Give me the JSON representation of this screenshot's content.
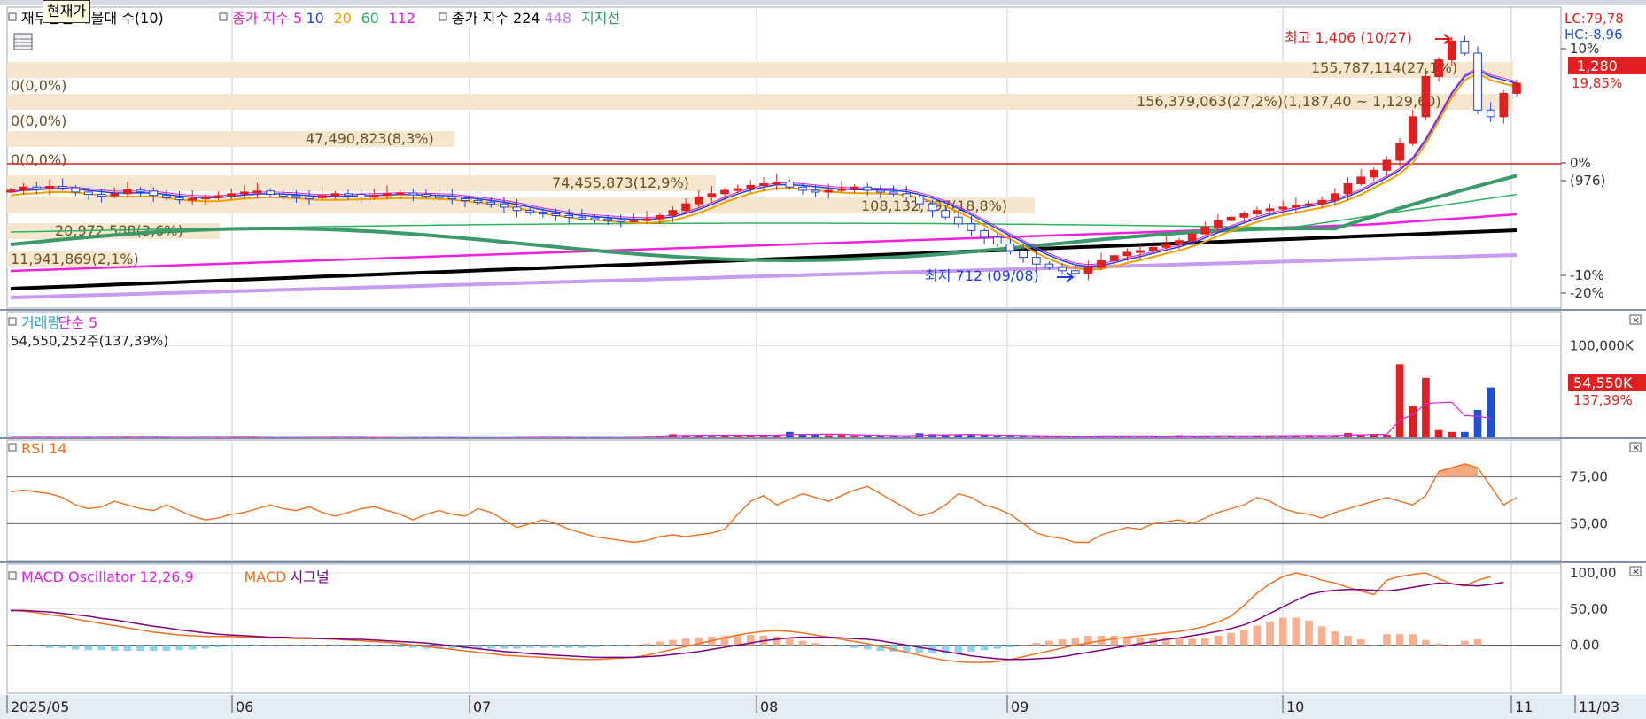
{
  "tooltip": "현재가",
  "legends": {
    "price": [
      {
        "text": "재무관련 매물대 수(10)",
        "color": "#000000"
      },
      {
        "text": "종가 지수 5",
        "color": "#e020c0"
      },
      {
        "text": "10",
        "color": "#2040e0"
      },
      {
        "text": "20",
        "color": "#f0a000"
      },
      {
        "text": "60",
        "color": "#30b060"
      },
      {
        "text": "112",
        "color": "#e020e0"
      },
      {
        "text": "종가 지수 224",
        "color": "#000000"
      },
      {
        "text": "448",
        "color": "#c080f0"
      },
      {
        "text": "지지선",
        "color": "#30a060"
      }
    ],
    "volume": [
      {
        "text": "거래량",
        "color": "#20a0c0"
      },
      {
        "text": "단순 5",
        "color": "#e020e0"
      }
    ],
    "volume_info": "54,550,252주(137,39%)",
    "rsi": [
      {
        "text": "RSI 14",
        "color": "#f07020"
      }
    ],
    "macd": [
      {
        "text": "MACD Oscillator 12,26,9",
        "color": "#e020e0"
      },
      {
        "text": "MACD",
        "color": "#f07020"
      },
      {
        "text": "시그널",
        "color": "#800080"
      }
    ]
  },
  "right_axis": {
    "lc": "LC:79,78",
    "hc": "HC:-8,96",
    "price_badge": "1,280",
    "price_change": "19,85%",
    "price_ticks": [
      "10%",
      "0%",
      "(976)",
      "-10%",
      "-20%"
    ],
    "volume_ticks": [
      "100,000K"
    ],
    "volume_badge": "54,550K",
    "volume_change": "137,39%",
    "rsi_ticks": [
      "75,00",
      "50,00"
    ],
    "macd_ticks": [
      "100,00",
      "50,00",
      "0,00"
    ]
  },
  "x_axis": {
    "labels": [
      "2025/05",
      "06",
      "07",
      "08",
      "09",
      "10",
      "11",
      "11/03"
    ]
  },
  "annotations": {
    "high": "최고 1,406 (10/27)",
    "low": "최저 712 (09/08)"
  },
  "chart_data": {
    "type": "candlestick",
    "x_range": [
      "2025/05",
      "11/03"
    ],
    "price": {
      "current": 1280,
      "high": {
        "value": 1406,
        "date": "10/27"
      },
      "low": {
        "value": 712,
        "date": "09/08"
      },
      "reference": 976,
      "closes": [
        960,
        970,
        965,
        972,
        968,
        955,
        948,
        944,
        950,
        962,
        958,
        945,
        938,
        932,
        936,
        940,
        944,
        950,
        955,
        958,
        948,
        944,
        940,
        938,
        945,
        950,
        948,
        940,
        945,
        950,
        952,
        948,
        944,
        940,
        935,
        930,
        925,
        920,
        910,
        900,
        895,
        890,
        885,
        880,
        878,
        875,
        872,
        870,
        872,
        875,
        885,
        900,
        920,
        940,
        950,
        960,
        965,
        975,
        980,
        985,
        970,
        960,
        955,
        960,
        965,
        970,
        960,
        955,
        950,
        940,
        920,
        900,
        880,
        860,
        840,
        820,
        800,
        780,
        760,
        740,
        730,
        720,
        712,
        730,
        750,
        765,
        775,
        780,
        790,
        800,
        810,
        830,
        850,
        870,
        880,
        890,
        900,
        905,
        910,
        915,
        920,
        930,
        950,
        980,
        1000,
        1020,
        1050,
        1100,
        1180,
        1300,
        1350,
        1406,
        1370,
        1200,
        1180,
        1250,
        1280
      ],
      "sma5": [
        955,
        960,
        962,
        965,
        966,
        964,
        960,
        956,
        952,
        952,
        953,
        952,
        948,
        943,
        940,
        938,
        938,
        942,
        946,
        949,
        950,
        949,
        947,
        944,
        942,
        942,
        943,
        944,
        945,
        946,
        948,
        947,
        946,
        945,
        943,
        939,
        935,
        930,
        925,
        918,
        910,
        902,
        896,
        890,
        885,
        882,
        879,
        876,
        874,
        873,
        876,
        881,
        891,
        903,
        918,
        935,
        949,
        961,
        970,
        977,
        977,
        975,
        971,
        967,
        964,
        962,
        962,
        961,
        960,
        956,
        948,
        937,
        923,
        906,
        887,
        866,
        845,
        825,
        805,
        784,
        766,
        750,
        738,
        733,
        736,
        744,
        754,
        762,
        772,
        782,
        791,
        803,
        818,
        834,
        849,
        863,
        876,
        887,
        896,
        904,
        912,
        919,
        928,
        942,
        958,
        978,
        998,
        1020,
        1054,
        1110,
        1178,
        1248,
        1300,
        1320,
        1300,
        1290,
        1280
      ],
      "ma224": [
        930,
        932,
        934,
        936,
        938,
        940,
        942,
        944,
        946,
        948,
        950,
        952,
        954,
        956,
        958,
        960,
        962,
        964,
        966,
        968,
        970,
        972,
        974,
        976,
        978,
        980,
        982,
        984,
        986,
        988,
        990,
        992,
        994,
        996,
        998,
        1000,
        1002,
        1004,
        1006,
        1008,
        1010,
        1012,
        1014,
        1016,
        1018,
        1020,
        1022,
        1024,
        1026,
        1028,
        1030,
        1032,
        1034,
        1036,
        1038,
        1040,
        1042,
        1044,
        1046,
        1048,
        1050,
        1052,
        1054,
        1056,
        1058,
        1060,
        1062,
        1064,
        1066,
        1068,
        1070,
        1072,
        1074,
        1076,
        1078,
        1080,
        1082,
        1084,
        1086,
        1088,
        1090,
        1092,
        1094,
        1096,
        1098,
        1100,
        1102,
        1104,
        1106,
        1108,
        1110,
        1112,
        1114,
        1116,
        1118,
        1120,
        1122,
        1124,
        1126,
        1128,
        1130,
        1132,
        1134,
        1136,
        1138,
        1140,
        1142,
        1144,
        1146,
        1148,
        1150,
        1152,
        1154,
        1156,
        1158
      ]
    },
    "volume_profile": [
      {
        "label": "0(0,0%)",
        "pct": 0
      },
      {
        "label": "155,787,114(27,1%)",
        "pct": 27.1
      },
      {
        "label": "0(0,0%)",
        "pct": 0
      },
      {
        "label": "156,379,063(27,2%)(1,187,40 ~ 1,129,60)",
        "pct": 27.2
      },
      {
        "label": "47,490,823(8,3%)",
        "pct": 8.3
      },
      {
        "label": "0(0,0%)",
        "pct": 0
      },
      {
        "label": "74,455,873(12,9%)",
        "pct": 12.9
      },
      {
        "label": "108,132,797(18,8%)",
        "pct": 18.8
      },
      {
        "label": "20,972,588(3,6%)",
        "pct": 3.6
      },
      {
        "label": "11,941,869(2,1%)",
        "pct": 2.1
      }
    ],
    "volume": {
      "last": 54550252,
      "last_pct": 137.39,
      "values_k": [
        1000,
        900,
        1200,
        800,
        1100,
        900,
        700,
        1500,
        1200,
        900,
        1000,
        800,
        700,
        900,
        1100,
        1300,
        900,
        800,
        1000,
        700,
        600,
        800,
        900,
        1200,
        1000,
        900,
        800,
        700,
        600,
        700,
        800,
        900,
        800,
        700,
        600,
        500,
        700,
        800,
        900,
        1000,
        1100,
        900,
        800,
        700,
        600,
        800,
        900,
        1000,
        1200,
        1500,
        2000,
        3500,
        2200,
        2500,
        1800,
        2000,
        3000,
        2400,
        2200,
        2000,
        6000,
        3800,
        3000,
        2500,
        2800,
        2200,
        2000,
        1800,
        1500,
        1200,
        4500,
        3600,
        3200,
        2500,
        2800,
        2400,
        2000,
        1800,
        1600,
        1500,
        1400,
        1200,
        1300,
        1600,
        2000,
        1800,
        1500,
        1200,
        1000,
        1400,
        2400,
        1900,
        1500,
        1300,
        1700,
        1900,
        2200,
        1800,
        1600,
        2400,
        2000,
        1800,
        2200,
        4800,
        3200,
        3800,
        2800,
        80000,
        34000,
        65000,
        8000,
        6000,
        6000,
        30000,
        54550
      ]
    },
    "rsi": {
      "levels": [
        75,
        50
      ],
      "values": [
        67,
        68,
        67,
        66,
        64,
        60,
        58,
        59,
        62,
        60,
        58,
        57,
        60,
        57,
        54,
        52,
        53,
        55,
        56,
        58,
        60,
        58,
        57,
        59,
        56,
        54,
        56,
        58,
        59,
        57,
        55,
        52,
        55,
        57,
        55,
        54,
        58,
        56,
        52,
        48,
        50,
        52,
        50,
        47,
        45,
        43,
        42,
        41,
        40,
        41,
        43,
        44,
        43,
        44,
        45,
        47,
        55,
        62,
        65,
        60,
        63,
        66,
        64,
        62,
        65,
        68,
        70,
        66,
        62,
        58,
        54,
        56,
        60,
        66,
        64,
        60,
        58,
        55,
        50,
        45,
        43,
        42,
        40,
        40,
        44,
        46,
        48,
        47,
        50,
        51,
        52,
        50,
        53,
        56,
        58,
        60,
        64,
        62,
        58,
        56,
        55,
        53,
        56,
        58,
        60,
        62,
        64,
        62,
        60,
        65,
        78,
        80,
        82,
        80,
        70,
        60,
        64
      ]
    },
    "macd": {
      "levels": [
        100,
        50,
        0
      ],
      "macd": [
        48,
        47,
        45,
        42,
        40,
        36,
        33,
        30,
        27,
        24,
        21,
        18,
        16,
        14,
        13,
        12,
        12,
        12,
        11,
        11,
        10,
        10,
        9,
        9,
        9,
        8,
        7,
        6,
        5,
        4,
        2,
        0,
        -2,
        -4,
        -6,
        -8,
        -10,
        -12,
        -14,
        -15,
        -16,
        -17,
        -18,
        -19,
        -20,
        -20,
        -19,
        -18,
        -17,
        -14,
        -10,
        -6,
        -2,
        2,
        6,
        10,
        14,
        17,
        19,
        20,
        19,
        17,
        14,
        11,
        8,
        5,
        2,
        -2,
        -6,
        -10,
        -14,
        -18,
        -21,
        -23,
        -24,
        -24,
        -23,
        -20,
        -16,
        -12,
        -8,
        -4,
        0,
        3,
        6,
        9,
        11,
        13,
        15,
        17,
        19,
        22,
        26,
        32,
        40,
        55,
        72,
        85,
        95,
        100,
        96,
        90,
        86,
        80,
        75,
        70,
        90,
        95,
        98,
        100,
        92,
        85,
        82,
        90,
        95
      ],
      "signal": [
        48,
        48,
        47,
        46,
        44,
        42,
        40,
        37,
        35,
        32,
        29,
        26,
        24,
        21,
        19,
        17,
        15,
        14,
        13,
        12,
        11,
        11,
        10,
        10,
        9,
        9,
        8,
        8,
        7,
        6,
        5,
        4,
        3,
        1,
        -1,
        -3,
        -5,
        -7,
        -9,
        -10,
        -12,
        -13,
        -14,
        -15,
        -16,
        -17,
        -17,
        -17,
        -17,
        -16,
        -15,
        -13,
        -11,
        -9,
        -6,
        -3,
        0,
        3,
        6,
        8,
        10,
        11,
        11,
        11,
        10,
        9,
        8,
        6,
        3,
        0,
        -3,
        -6,
        -9,
        -12,
        -15,
        -17,
        -19,
        -20,
        -20,
        -19,
        -18,
        -16,
        -13,
        -10,
        -7,
        -4,
        -1,
        2,
        5,
        8,
        10,
        13,
        16,
        19,
        23,
        28,
        35,
        44,
        53,
        62,
        70,
        74,
        76,
        77,
        77,
        76,
        75,
        77,
        80,
        83,
        86,
        85,
        83,
        82,
        84,
        87
      ],
      "oscillator": [
        0,
        -1,
        -2,
        -4,
        -4,
        -6,
        -7,
        -7,
        -8,
        -8,
        -8,
        -8,
        -8,
        -7,
        -6,
        -5,
        -3,
        -2,
        -2,
        -1,
        -1,
        -1,
        -1,
        -1,
        0,
        -1,
        -1,
        -2,
        -2,
        -2,
        -3,
        -4,
        -5,
        -5,
        -5,
        -5,
        -5,
        -5,
        -5,
        -5,
        -4,
        -4,
        -4,
        -4,
        -4,
        -3,
        -2,
        -1,
        0,
        2,
        5,
        7,
        9,
        11,
        12,
        13,
        14,
        14,
        13,
        12,
        9,
        6,
        3,
        0,
        -2,
        -4,
        -6,
        -8,
        -9,
        -10,
        -11,
        -12,
        -12,
        -11,
        -9,
        -7,
        -5,
        -3,
        0,
        3,
        6,
        8,
        10,
        13,
        13,
        13,
        12,
        11,
        10,
        9,
        9,
        9,
        10,
        13,
        17,
        21,
        27,
        33,
        38,
        38,
        34,
        26,
        19,
        13,
        8,
        -2,
        15,
        15,
        15,
        7,
        2,
        0,
        6,
        8
      ]
    }
  }
}
